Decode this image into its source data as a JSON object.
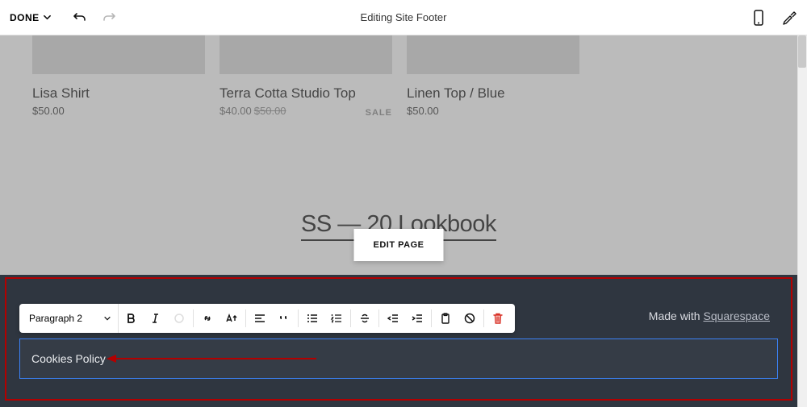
{
  "topbar": {
    "done_label": "DONE",
    "title": "Editing Site Footer"
  },
  "products": [
    {
      "name": "Lisa Shirt",
      "price": "$50.00",
      "sale_price": "",
      "orig_price": "",
      "on_sale": false
    },
    {
      "name": "Terra Cotta Studio Top",
      "price": "",
      "sale_price": "$40.00",
      "orig_price": "$50.00",
      "on_sale": true,
      "badge": "SALE"
    },
    {
      "name": "Linen Top / Blue",
      "price": "$50.00",
      "sale_price": "",
      "orig_price": "",
      "on_sale": false
    }
  ],
  "lookbook": {
    "title": "SS — 20 Lookbook"
  },
  "edit_page_label": "EDIT PAGE",
  "toolbar": {
    "style_label": "Paragraph 2"
  },
  "footer": {
    "madewith_prefix": "Made with ",
    "madewith_brand": "Squarespace",
    "text_block": "Cookies Policy"
  }
}
